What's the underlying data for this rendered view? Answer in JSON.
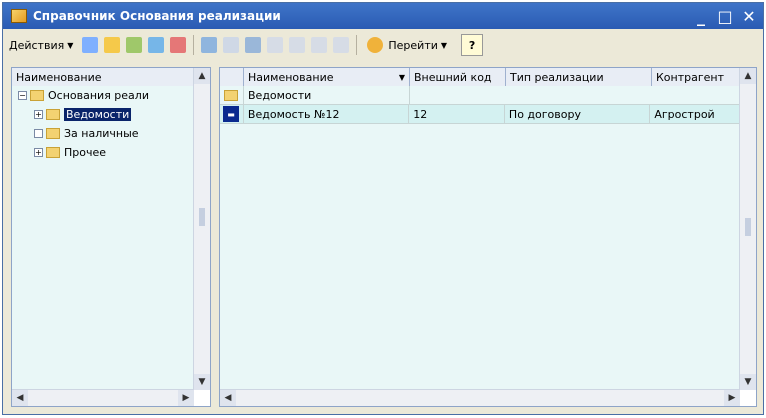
{
  "window": {
    "title": "Справочник Основания реализации"
  },
  "toolbar": {
    "actions_label": "Действия",
    "goto_label": "Перейти",
    "help_label": "?"
  },
  "tree": {
    "header": "Наименование",
    "items": [
      {
        "label": "Основания реали"
      },
      {
        "label": "Ведомости"
      },
      {
        "label": "За наличные"
      },
      {
        "label": "Прочее"
      }
    ]
  },
  "grid": {
    "headers": [
      "Наименование",
      "Внешний код",
      "Тип реализации",
      "Контрагент"
    ],
    "group_row": {
      "label": "Ведомости"
    },
    "rows": [
      {
        "name": "Ведомость №12",
        "code": "12",
        "type": "По договору",
        "counterparty": "Агрострой"
      }
    ]
  },
  "colors": {
    "selection": "#0a246a",
    "list_bg": "#e9f7f7",
    "title_bar": "#2a5bb3"
  }
}
